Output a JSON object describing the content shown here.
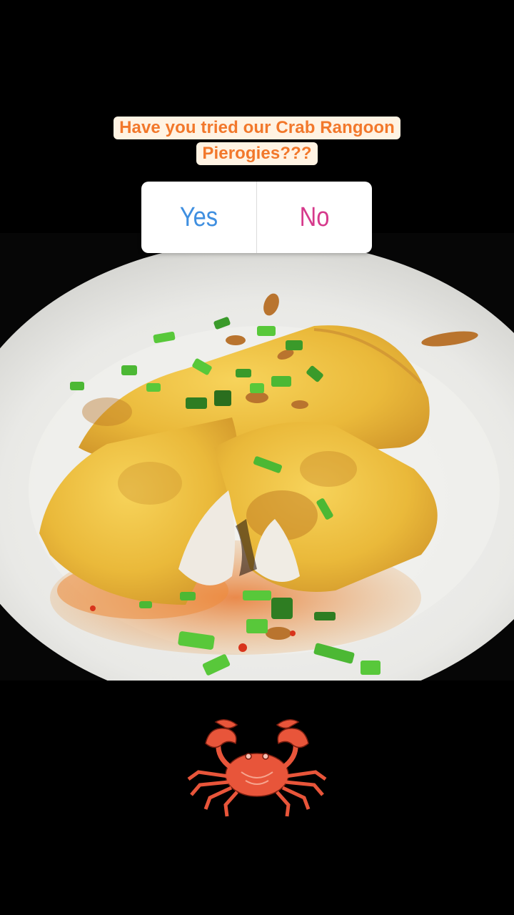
{
  "question": {
    "line1": "Have you tried our Crab Rangoon",
    "line2": "Pierogies???"
  },
  "poll": {
    "options": [
      {
        "label": "Yes",
        "color": "#3f8fe0"
      },
      {
        "label": "No",
        "color": "#d63a8c"
      }
    ]
  },
  "colors": {
    "background": "#000000",
    "question_text": "#f2782b",
    "question_bg": "#fff3e3",
    "logo": "#e8553a"
  },
  "icons": {
    "photo": "plate-of-crab-rangoon-pierogies",
    "logo": "crab-icon"
  }
}
